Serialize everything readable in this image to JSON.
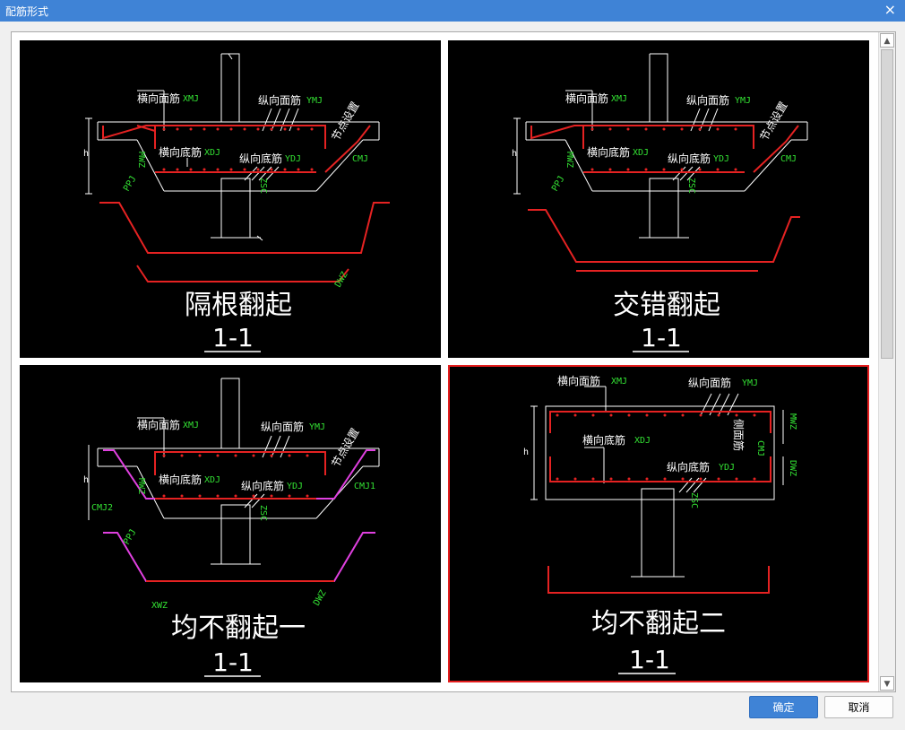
{
  "window": {
    "title": "配筋形式",
    "close_symbol": "×"
  },
  "colors": {
    "titlebar": "#3f83d6",
    "selected_border": "#e51d1d",
    "rebar": "#e52222",
    "magenta": "#e040e0",
    "label": "#33e033",
    "line": "#ffffff"
  },
  "panels": [
    {
      "name": "隔根翻起",
      "section": "1-1",
      "selected": false,
      "labels": {
        "xmj_cn": "横向面筋",
        "xmj": "XMJ",
        "ymj_cn": "纵向面筋",
        "ymj": "YMJ",
        "xdj_cn": "横向底筋",
        "xdj": "XDJ",
        "ydj_cn": "纵向底筋",
        "ydj": "YDJ",
        "node_cn": "节点设置",
        "cmj": "CMJ",
        "mwz": "MWZ",
        "ppj": "PPJ",
        "h": "h",
        "zsc": "ZSC",
        "dwz": "DWZ"
      }
    },
    {
      "name": "交错翻起",
      "section": "1-1",
      "selected": false,
      "labels": {
        "xmj_cn": "横向面筋",
        "xmj": "XMJ",
        "ymj_cn": "纵向面筋",
        "ymj": "YMJ",
        "xdj_cn": "横向底筋",
        "xdj": "XDJ",
        "ydj_cn": "纵向底筋",
        "ydj": "YDJ",
        "node_cn": "节点设置",
        "cmj": "CMJ",
        "mwz": "MWZ",
        "ppj": "PPJ",
        "h": "h",
        "zsc": "ZSC"
      }
    },
    {
      "name": "均不翻起一",
      "section": "1-1",
      "selected": false,
      "labels": {
        "xmj_cn": "横向面筋",
        "xmj": "XMJ",
        "ymj_cn": "纵向面筋",
        "ymj": "YMJ",
        "xdj_cn": "横向底筋",
        "xdj": "XDJ",
        "ydj_cn": "纵向底筋",
        "ydj": "YDJ",
        "node_cn": "节点设置",
        "cmj1": "CMJ1",
        "cmj2": "CMJ2",
        "mwz": "MWZ",
        "ppj": "PPJ",
        "h": "h",
        "zsc": "ZSC",
        "dwz": "DWZ",
        "xwz": "XWZ"
      }
    },
    {
      "name": "均不翻起二",
      "section": "1-1",
      "selected": true,
      "labels": {
        "xmj_cn": "横向面筋",
        "xmj": "XMJ",
        "ymj_cn": "纵向面筋",
        "ymj": "YMJ",
        "xdj_cn": "横向底筋",
        "xdj": "XDJ",
        "ydj_cn": "纵向底筋",
        "ydj": "YDJ",
        "side_cn": "侧面筋",
        "cmj": "CMJ",
        "mwz": "MWZ",
        "dwz": "DWZ",
        "h": "h",
        "zsc": "ZSC"
      }
    }
  ],
  "buttons": {
    "ok": "确定",
    "cancel": "取消"
  }
}
